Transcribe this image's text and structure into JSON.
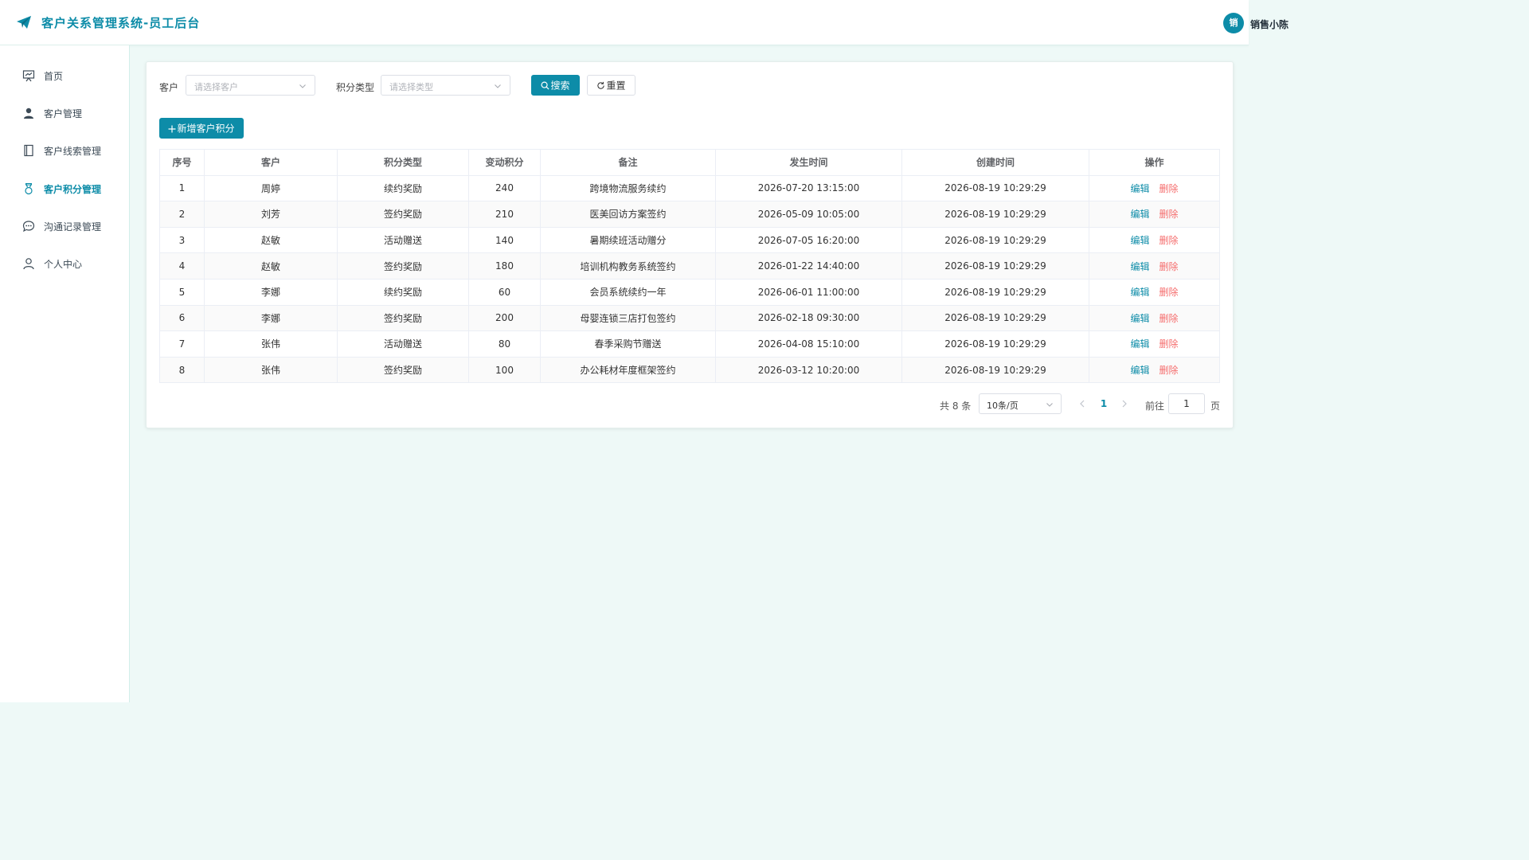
{
  "header": {
    "title": "客户关系管理系统-员工后台",
    "avatar_text": "销",
    "user_name": "销售小陈",
    "accent_color": "#0d8ca8"
  },
  "sidebar": {
    "items": [
      {
        "label": "首页",
        "icon": "presentation-icon"
      },
      {
        "label": "客户管理",
        "icon": "user-icon"
      },
      {
        "label": "客户线索管理",
        "icon": "notebook-icon"
      },
      {
        "label": "客户积分管理",
        "icon": "medal-icon",
        "active": true
      },
      {
        "label": "沟通记录管理",
        "icon": "chat-icon"
      },
      {
        "label": "个人中心",
        "icon": "user-outline-icon"
      }
    ]
  },
  "filters": {
    "customer_label": "客户",
    "customer_placeholder": "请选择客户",
    "type_label": "积分类型",
    "type_placeholder": "请选择类型",
    "search_label": "搜索",
    "reset_label": "重置"
  },
  "toolbar": {
    "add_label": "新增客户积分"
  },
  "table": {
    "columns": [
      "序号",
      "客户",
      "积分类型",
      "变动积分",
      "备注",
      "发生时间",
      "创建时间",
      "操作"
    ],
    "edit_label": "编辑",
    "delete_label": "删除",
    "rows": [
      [
        "1",
        "周婷",
        "续约奖励",
        "240",
        "跨境物流服务续约",
        "2026-07-20 13:15:00",
        "2026-08-19 10:29:29"
      ],
      [
        "2",
        "刘芳",
        "签约奖励",
        "210",
        "医美回访方案签约",
        "2026-05-09 10:05:00",
        "2026-08-19 10:29:29"
      ],
      [
        "3",
        "赵敏",
        "活动赠送",
        "140",
        "暑期续班活动赠分",
        "2026-07-05 16:20:00",
        "2026-08-19 10:29:29"
      ],
      [
        "4",
        "赵敏",
        "签约奖励",
        "180",
        "培训机构教务系统签约",
        "2026-01-22 14:40:00",
        "2026-08-19 10:29:29"
      ],
      [
        "5",
        "李娜",
        "续约奖励",
        "60",
        "会员系统续约一年",
        "2026-06-01 11:00:00",
        "2026-08-19 10:29:29"
      ],
      [
        "6",
        "李娜",
        "签约奖励",
        "200",
        "母婴连锁三店打包签约",
        "2026-02-18 09:30:00",
        "2026-08-19 10:29:29"
      ],
      [
        "7",
        "张伟",
        "活动赠送",
        "80",
        "春季采购节赠送",
        "2026-04-08 15:10:00",
        "2026-08-19 10:29:29"
      ],
      [
        "8",
        "张伟",
        "签约奖励",
        "100",
        "办公耗材年度框架签约",
        "2026-03-12 10:20:00",
        "2026-08-19 10:29:29"
      ]
    ]
  },
  "pagination": {
    "total_text": "共 8 条",
    "page_size": "10条/页",
    "current_page": "1",
    "goto_label": "前往",
    "goto_value": "1",
    "page_unit": "页"
  }
}
